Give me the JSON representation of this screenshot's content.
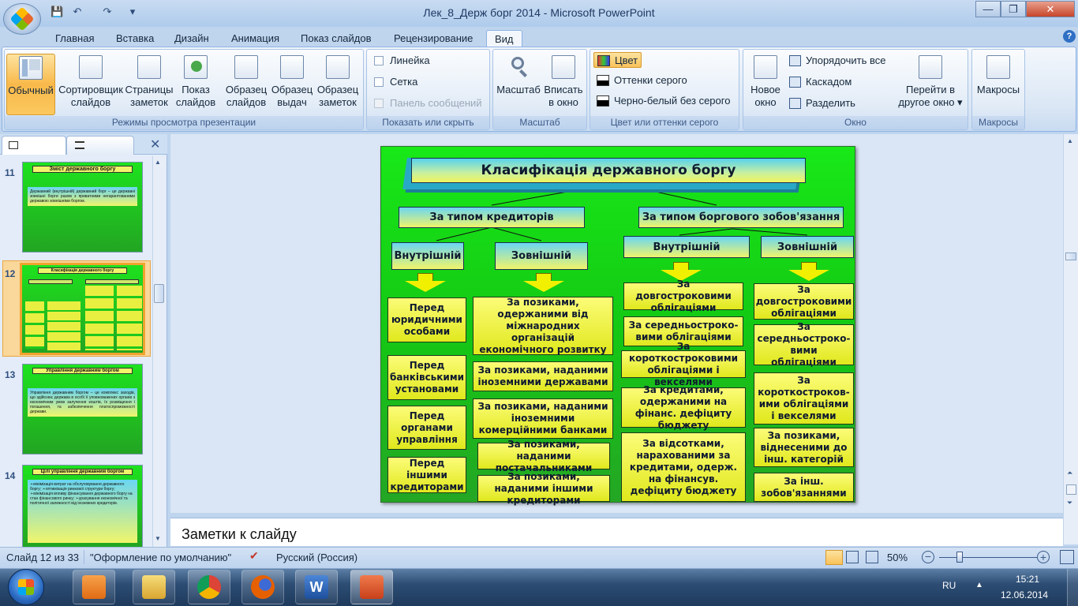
{
  "window": {
    "title": "Лек_8_Держ борг 2014 - Microsoft PowerPoint",
    "minimize": "—",
    "maximize": "❐",
    "close": "✕",
    "help": "?"
  },
  "quick_access": {
    "save": "💾",
    "undo": "↶",
    "redo": "↷",
    "more": "▾"
  },
  "tabs": [
    "Главная",
    "Вставка",
    "Дизайн",
    "Анимация",
    "Показ слайдов",
    "Рецензирование",
    "Вид"
  ],
  "active_tab": "Вид",
  "ribbon": {
    "views_group": {
      "label": "Режимы просмотра презентации",
      "buttons": [
        "Обычный",
        "Сортировщик слайдов",
        "Страницы заметок",
        "Показ слайдов",
        "Образец слайдов",
        "Образец выдач",
        "Образец заметок"
      ],
      "btn_lines": [
        [
          "Обычный",
          ""
        ],
        [
          "Сортировщик",
          "слайдов"
        ],
        [
          "Страницы",
          "заметок"
        ],
        [
          "Показ",
          "слайдов"
        ],
        [
          "Образец",
          "слайдов"
        ],
        [
          "Образец",
          "выдач"
        ],
        [
          "Образец",
          "заметок"
        ]
      ]
    },
    "show_group": {
      "label": "Показать или скрыть",
      "items": [
        "Линейка",
        "Сетка",
        "Панель сообщений"
      ]
    },
    "zoom_group": {
      "label": "Масштаб",
      "zoom": [
        "Масштаб",
        ""
      ],
      "fit": [
        "Вписать",
        "в окно"
      ]
    },
    "color_group": {
      "label": "Цвет или оттенки серого",
      "items": [
        "Цвет",
        "Оттенки серого",
        "Черно-белый без серого"
      ]
    },
    "window_group": {
      "label": "Окно",
      "new_window": [
        "Новое",
        "окно"
      ],
      "items": [
        "Упорядочить все",
        "Каскадом",
        "Разделить"
      ],
      "switch": [
        "Перейти в",
        "другое окно ▾"
      ]
    },
    "macros_group": {
      "label": "Макросы",
      "macros": "Макросы"
    }
  },
  "slides_pane": {
    "close": "✕",
    "thumbnails": [
      {
        "num": "11",
        "title": "Зміст державного боргу",
        "body": "Державний (внутрішній) державний борг – це державні зовнішні борги разом з приватними негарантованими державою зовнішніми боргом."
      },
      {
        "num": "12",
        "title": "Класифікація державного боргу"
      },
      {
        "num": "13",
        "title": "Управління державним боргом",
        "body": "Управління державним боргом – це комплекс заходів, що здійснює держава в особі її уповноважених органів з економічним умов залучення коштів, їх розміщення і погашення, та забезпечення платоспроможності держави."
      },
      {
        "num": "14",
        "title": "Цілі управління державним боргом",
        "body": "➢мінімізація витрат на обслуговування державного боргу; ➢оптимізація ринкової структури боргу; ➢мінімізація впливу фінансування державного боргу на стан фінансового ринку; ➢урахування економічної та політичної залежності від іноземних кредиторів."
      }
    ]
  },
  "slide": {
    "title": "Класифікація державного боргу",
    "cat_left": "За типом кредиторів",
    "cat_right": "За типом боргового зобов'язання",
    "left_internal": "Внутрішній",
    "left_external": "Зовнішній",
    "right_internal": "Внутрішній",
    "right_external": "Зовнішній",
    "col1": [
      "Перед юридичними особами",
      "Перед банківськими установами",
      "Перед органами управління",
      "Перед іншими кредиторами"
    ],
    "col2": [
      "За позиками, одержаними від міжнародних організацій економічного розвитку",
      "За позиками, наданими іноземними державами",
      "За позиками, наданими іноземними комерційними банками",
      "За позиками, наданими постачальниками",
      "За позиками, наданими іншими кредиторами"
    ],
    "col3": [
      "За довгостроковими облігаціями",
      "За середньостроко-вими облігаціями",
      "За короткостроковими облігаціями і векселями",
      "За кредитами, одержаними на фінанс. дефіциту бюджету",
      "За відсотками, нарахованими за кредитами, одерж. на фінансув. дефіциту бюджету"
    ],
    "col4": [
      "За довгостроковими облігаціями",
      "За середньостроко-вими облігаціями",
      "За короткостроков-ими облігаціями і векселями",
      "За позиками, віднесеними до інш. категорій",
      "За інш. зобов'язаннями"
    ]
  },
  "notes_placeholder": "Заметки к слайду",
  "status": {
    "slide_info": "Слайд 12 из 33",
    "theme": "\"Оформление по умолчанию\"",
    "language": "Русский (Россия)",
    "zoom": "50%"
  },
  "taskbar": {
    "lang": "RU",
    "time": "15:21",
    "date": "12.06.2014"
  },
  "colors": {
    "slide_bg": "#14c914",
    "box_yellow": "#f0f56a",
    "accent_ribbon": "#f9b94a"
  }
}
